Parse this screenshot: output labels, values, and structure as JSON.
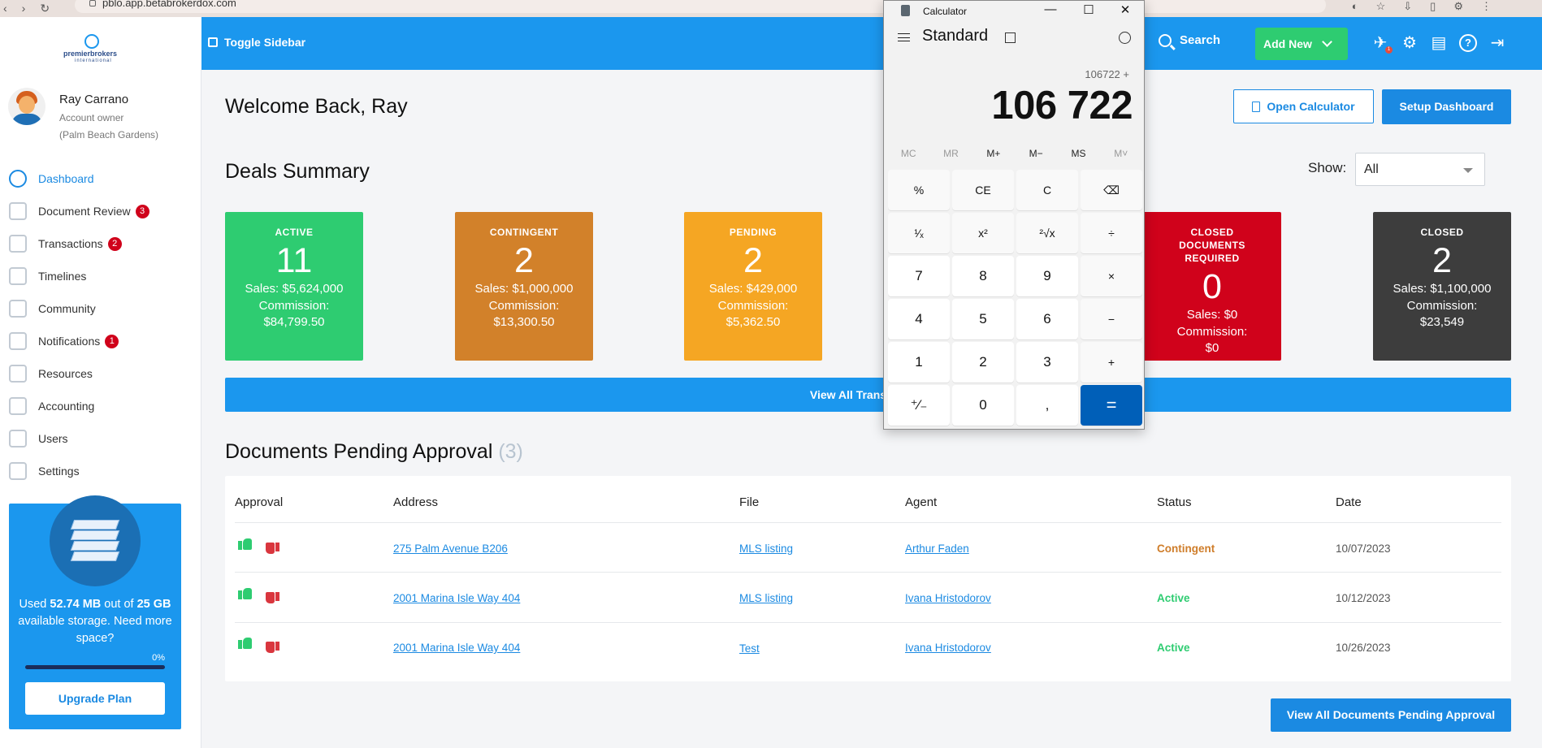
{
  "browser": {
    "url": "pblo.app.betabrokerdox.com"
  },
  "topbar": {
    "logo_text": "premierbrokers",
    "logo_sub": "international",
    "toggle_label": "Toggle Sidebar",
    "search_label": "Search",
    "add_new_label": "Add New",
    "notification_count": "1",
    "icons": [
      "rocket-icon",
      "gear-icon",
      "clipboard-icon",
      "help-icon",
      "logout-icon"
    ]
  },
  "profile": {
    "name": "Ray Carrano",
    "role": "Account owner",
    "location": "(Palm Beach Gardens)"
  },
  "sidebar": {
    "items": [
      {
        "label": "Dashboard",
        "badge": "",
        "icon": "speedometer-icon"
      },
      {
        "label": "Document Review",
        "badge": "3",
        "icon": "document-icon"
      },
      {
        "label": "Transactions",
        "badge": "2",
        "icon": "dollar-icon"
      },
      {
        "label": "Timelines",
        "badge": "",
        "icon": "timeline-icon"
      },
      {
        "label": "Community",
        "badge": "",
        "icon": "people-icon"
      },
      {
        "label": "Notifications",
        "badge": "1",
        "icon": "chat-icon"
      },
      {
        "label": "Resources",
        "badge": "",
        "icon": "folder-icon"
      },
      {
        "label": "Accounting",
        "badge": "",
        "icon": "calculator-icon"
      },
      {
        "label": "Users",
        "badge": "",
        "icon": "user-icon"
      },
      {
        "label": "Settings",
        "badge": "",
        "icon": "gear-icon"
      }
    ],
    "storage": {
      "used_prefix": "Used ",
      "used": "52.74 MB",
      "out_of": " out of ",
      "total": "25 GB",
      "suffix": " available storage. Need more space?",
      "percent_label": "0%",
      "percent": 0,
      "upgrade_label": "Upgrade Plan"
    }
  },
  "main": {
    "welcome": "Welcome Back, Ray",
    "open_calc_label": "Open Calculator",
    "setup_label": "Setup Dashboard",
    "deals_title": "Deals Summary",
    "show_label": "Show:",
    "show_value": "All",
    "view_all_trans_label": "View All Transactions",
    "docs_title": "Documents Pending Approval",
    "docs_count": "(3)",
    "view_all_docs_label": "View All Documents Pending Approval"
  },
  "deals": [
    {
      "title": "ACTIVE",
      "count": "11",
      "sales": "Sales: $5,624,000",
      "comm_label": "Commission:",
      "comm": "$84,799.50",
      "color": "#2ecc71"
    },
    {
      "title": "CONTINGENT",
      "count": "2",
      "sales": "Sales: $1,000,000",
      "comm_label": "Commission:",
      "comm": "$13,300.50",
      "color": "#d2812a"
    },
    {
      "title": "PENDING",
      "count": "2",
      "sales": "Sales: $429,000",
      "comm_label": "Commission:",
      "comm": "$5,362.50",
      "color": "#f5a623"
    },
    {
      "title": "CLOSED DOCUMENTS REQUIRED",
      "count": "0",
      "sales": "Sales: $0",
      "comm_label": "Commission:",
      "comm": "$0",
      "color": "#d0021b"
    },
    {
      "title": "CLOSED",
      "count": "2",
      "sales": "Sales: $1,100,000",
      "comm_label": "Commission:",
      "comm": "$23,549",
      "color": "#3d3d3d"
    }
  ],
  "docs_table": {
    "headers": [
      "Approval",
      "Address",
      "File",
      "Agent",
      "Status",
      "Date"
    ],
    "rows": [
      {
        "address": "275 Palm Avenue B206",
        "file": "MLS listing",
        "agent": "Arthur Faden",
        "status": "Contingent",
        "status_type": "cont",
        "date": "10/07/2023"
      },
      {
        "address": "2001 Marina Isle Way 404",
        "file": "MLS listing",
        "agent": "Ivana Hristodorov",
        "status": "Active",
        "status_type": "act",
        "date": "10/12/2023"
      },
      {
        "address": "2001 Marina Isle Way 404",
        "file": "Test",
        "agent": "Ivana Hristodorov",
        "status": "Active",
        "status_type": "act",
        "date": "10/26/2023"
      }
    ]
  },
  "calculator": {
    "window_title": "Calculator",
    "mode": "Standard",
    "expression": "106722 +",
    "display": "106 722",
    "memory": [
      "MC",
      "MR",
      "M+",
      "M−",
      "MS",
      "M˅"
    ],
    "keys": [
      "%",
      "CE",
      "C",
      "⌫",
      "¹⁄ₓ",
      "x²",
      "²√x",
      "÷",
      "7",
      "8",
      "9",
      "×",
      "4",
      "5",
      "6",
      "−",
      "1",
      "2",
      "3",
      "+",
      "⁺⁄₋",
      "0",
      ",",
      "="
    ]
  }
}
